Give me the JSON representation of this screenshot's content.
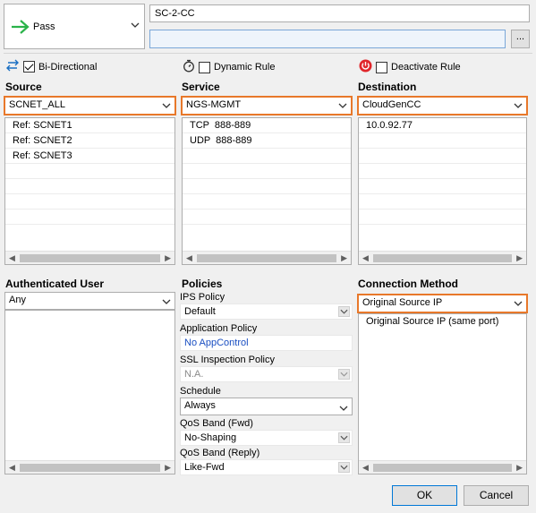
{
  "action": {
    "label": "Pass",
    "icon": "green-right-arrow-icon"
  },
  "rule_name": "SC-2-CC",
  "rule_description": "",
  "more_button_label": "...",
  "options": {
    "bidirectional": {
      "label": "Bi-Directional",
      "checked": true
    },
    "dynamic_rule": {
      "label": "Dynamic Rule",
      "checked": false
    },
    "deactivate_rule": {
      "label": "Deactivate Rule",
      "checked": false
    }
  },
  "source": {
    "title": "Source",
    "selected": "SCNET_ALL",
    "items": [
      "Ref: SCNET1",
      "Ref: SCNET2",
      "Ref: SCNET3"
    ]
  },
  "service": {
    "title": "Service",
    "selected": "NGS-MGMT",
    "items": [
      "TCP  888-889",
      "UDP  888-889"
    ]
  },
  "destination": {
    "title": "Destination",
    "selected": "CloudGenCC",
    "items": [
      "10.0.92.77"
    ]
  },
  "authenticated_user": {
    "title": "Authenticated User",
    "selected": "Any"
  },
  "policies": {
    "title": "Policies",
    "ips_policy": {
      "label": "IPS Policy",
      "value": "Default"
    },
    "application_policy": {
      "label": "Application Policy",
      "value": "No AppControl"
    },
    "ssl_inspection_policy": {
      "label": "SSL Inspection Policy",
      "value": "N.A."
    },
    "schedule": {
      "label": "Schedule",
      "value": "Always"
    },
    "qos_fwd": {
      "label": "QoS Band (Fwd)",
      "value": "No-Shaping"
    },
    "qos_reply": {
      "label": "QoS Band (Reply)",
      "value": "Like-Fwd"
    }
  },
  "connection_method": {
    "title": "Connection Method",
    "selected": "Original Source IP",
    "items": [
      "Original Source IP (same port)"
    ]
  },
  "buttons": {
    "ok": "OK",
    "cancel": "Cancel"
  },
  "colors": {
    "highlight_border": "#e8782a",
    "accent_blue": "#1a4fc2",
    "pass_green": "#2bb34a"
  }
}
